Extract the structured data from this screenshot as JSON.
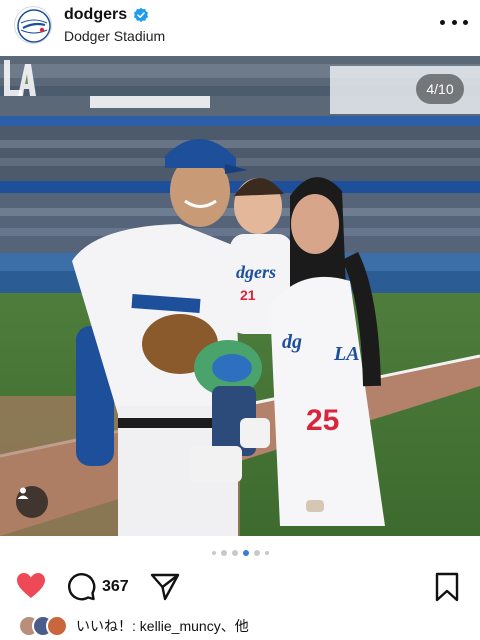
{
  "post": {
    "username": "dodgers",
    "location": "Dodger Stadium",
    "verified": true,
    "avatar_icon": "dodgers-logo",
    "media_counter": "4/10",
    "carousel": {
      "current": 4,
      "total": 10
    },
    "watermark": "LA"
  },
  "actions": {
    "comment_count": "367",
    "like_icon": "heart-filled-icon",
    "like_color": "#ed4956",
    "comment_icon": "comment-bubble-icon",
    "share_icon": "send-icon",
    "save_icon": "bookmark-icon"
  },
  "likes": {
    "text": "いいね！: kellie_muncy、他"
  },
  "colors": {
    "dodger_blue": "#1d4f9b",
    "verified_blue": "#1d9bf0",
    "active_dot": "#3a7bd5"
  }
}
